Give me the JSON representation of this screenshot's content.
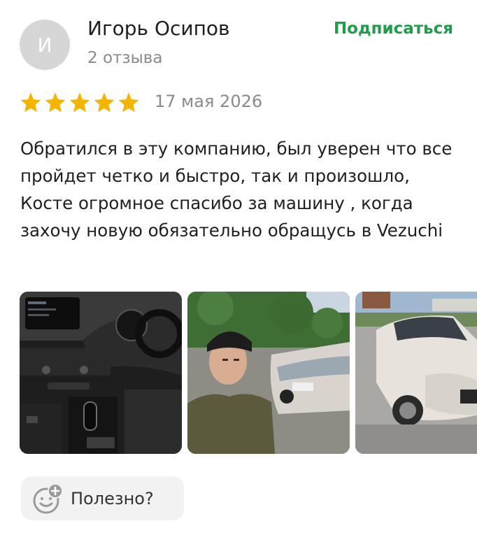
{
  "author": {
    "initial": "И",
    "name": "Игорь Осипов",
    "reviews": "2 отзыва",
    "subscribe_label": "Подписаться"
  },
  "review": {
    "rating": 5,
    "date": "17 мая 2026",
    "text": "Обратился в эту компанию, был уверен что все пройдет четко и быстро, так и произошло, Косте огромное спасибо за машину , когда захочу новую обязательно обращусь в Vezuchi"
  },
  "photos": [
    {
      "name": "car-interior-photo"
    },
    {
      "name": "customer-selfie-photo"
    },
    {
      "name": "white-car-photo"
    }
  ],
  "useful_button": {
    "label": "Полезно?"
  },
  "colors": {
    "accent": "#1e9e4a",
    "star": "#f5b400",
    "muted": "#8a8a8a",
    "avatar_bg": "#d6d6d6"
  }
}
